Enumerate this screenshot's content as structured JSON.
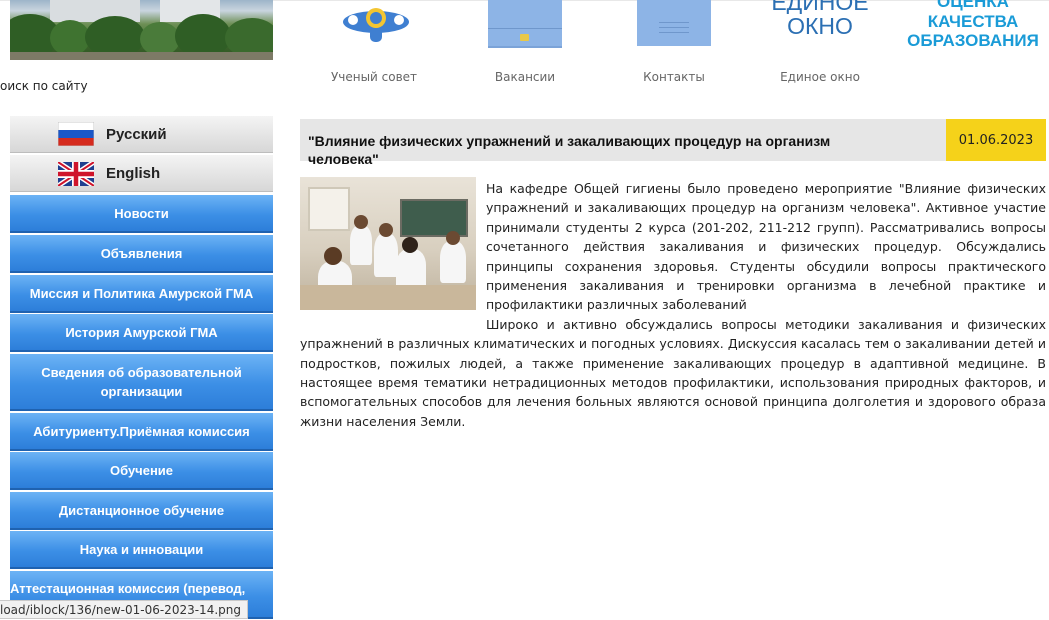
{
  "header": {
    "search_label": "оиск по сайту",
    "quick_links": [
      {
        "label": "Ученый совет",
        "icon": "council-icon"
      },
      {
        "label": "Вакансии",
        "icon": "vacancies-icon"
      },
      {
        "label": "Контакты",
        "icon": "contacts-icon"
      },
      {
        "label": "Единое окно",
        "icon": "single-window-icon"
      }
    ],
    "single_window_logo": {
      "line1": "ЕДИНОЕ",
      "line2": "ОКНО"
    },
    "quality_logo": {
      "line1": "ОЦЕНКА",
      "line2": "КАЧЕСТВА",
      "line3": "ОБРАЗОВАНИЯ"
    }
  },
  "languages": [
    {
      "label": "Русский",
      "flag": "russia-flag-icon"
    },
    {
      "label": "English",
      "flag": "uk-flag-icon"
    }
  ],
  "sidebar": {
    "items": [
      {
        "label": "Новости"
      },
      {
        "label": "Объявления"
      },
      {
        "label": "Миссия и Политика Амурской ГМА"
      },
      {
        "label": "История Амурской ГМА"
      },
      {
        "label": "Сведения об образовательной организации"
      },
      {
        "label": "Абитуриенту.Приёмная комиссия"
      },
      {
        "label": "Обучение"
      },
      {
        "label": "Дистанционное обучение"
      },
      {
        "label": "Наука и инновации"
      },
      {
        "label": "Аттестационная комиссия (перевод,"
      }
    ]
  },
  "status_bar": {
    "url": "load/iblock/136/new-01-06-2023-14.png"
  },
  "article": {
    "title_line1": "\"Влияние физических упражнений и закаливающих процедур на организм",
    "title_line2": "человека\"",
    "date": "01.06.2023",
    "paragraph1": "На кафедре Общей гигиены было проведено мероприятие \"Влияние физических упражнений и закаливающих процедур на организм человека\". Активное участие принимали студенты 2 курса (201-202, 211-212 групп). Рассматривались вопросы сочетанного действия закаливания и физических процедур. Обсуждались принципы сохранения здоровья. Студенты обсудили вопросы практического применения закаливания и тренировки организма в лечебной практике и профилактики различных заболеваний",
    "paragraph2": "Широко и активно обсуждались вопросы методики закаливания и физических упражнений в различных климатических и погодных условиях. Дискуссия касалась тем о закаливании детей и подростков, пожилых людей, а также применение закаливающих процедур в адаптивной медицине. В настоящее время тематики нетрадиционных методов профилактики, использования природных факторов, и вспомогательных способов для лечения больных являются основой принципа долголетия и здорового образа жизни населения Земли."
  },
  "colors": {
    "nav_blue": "#3c8fe6",
    "date_yellow": "#f5d21a",
    "title_bar_gray": "#e6e6e6",
    "logo_blue": "#2b6fb3",
    "quality_cyan": "#1a9bd7"
  }
}
